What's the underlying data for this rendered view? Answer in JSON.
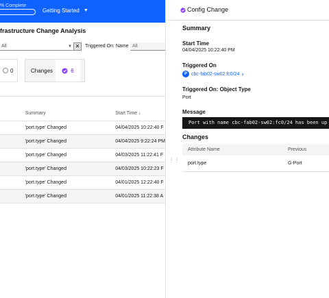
{
  "topbar": {
    "progress_label": "% Complete",
    "progress_fraction": 0.0,
    "getting_started_label": "Getting Started",
    "getting_started_caret": "▼"
  },
  "page": {
    "title": "frastructure Change Analysis"
  },
  "filters": {
    "first_value": "All",
    "first_arrow": "▼",
    "clear_glyph": "✕",
    "triggered_on_label": "Triggered On: Name",
    "triggered_on_value": "All"
  },
  "tiles": {
    "a_value": "0",
    "changes_label": "Changes",
    "changes_value": "6"
  },
  "events_table": {
    "headers": [
      "",
      "Summary",
      "Start Time ↓"
    ],
    "rows": [
      {
        "summary": "'port.type' Changed",
        "start_time": "04/04/2025 10:22:40 F"
      },
      {
        "summary": "'port.type' Changed",
        "start_time": "04/04/2025 9:22:24 PM"
      },
      {
        "summary": "'port.type' Changed",
        "start_time": "04/03/2025 11:22:41 F"
      },
      {
        "summary": "'port.type' Changed",
        "start_time": "04/03/2025 10:22:23 F"
      },
      {
        "summary": "'port.type' Changed",
        "start_time": "04/01/2025 12:22:40 F"
      },
      {
        "summary": "'port.type' Changed",
        "start_time": "04/01/2025 11:22:38 A"
      }
    ]
  },
  "panel": {
    "title": "Config Change",
    "summary_heading": "Summary",
    "start_time_label": "Start Time",
    "start_time_value": "04/04/2025 10:22:40 PM",
    "triggered_on_label": "Triggered On",
    "triggered_on_badge": "P",
    "triggered_on_link": "cbc-fab02-sw02:fc0/24",
    "triggered_on_chevron": "›",
    "object_type_label": "Triggered On: Object Type",
    "object_type_value": "Port",
    "message_label": "Message",
    "message_value": "Port with name cbc-fab02-sw02:fc0/24 has been up",
    "changes_heading": "Changes",
    "changes_headers": [
      "Attribute Name",
      "Previous"
    ],
    "changes_rows": [
      {
        "attribute": "port.type",
        "previous": "G-Port"
      }
    ]
  },
  "colors": {
    "brand": "#0f62fe",
    "accent": "#8a3ffc"
  },
  "icons": [
    "caret-down-icon",
    "close-icon",
    "config-change-icon",
    "port-badge-icon",
    "chevron-right-icon",
    "drag-handle-icon"
  ]
}
